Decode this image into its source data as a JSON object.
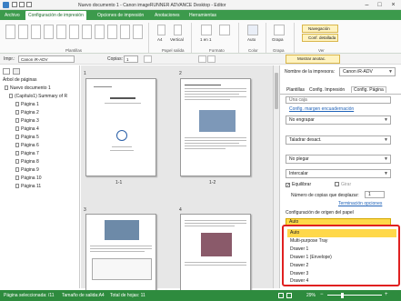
{
  "window": {
    "title": "Nuevo documento 1 - Canon imageRUNNER ADVANCE Desktop - Editor"
  },
  "ribbon_tabs": [
    "Archivo",
    "Configuración de impresión",
    "Opciones de impresión",
    "Anotaciones",
    "Herramientas"
  ],
  "ribbon": {
    "groups": [
      "Plantillas",
      "Papel salida",
      "Formato",
      "Color",
      "Grapa",
      "Ver"
    ],
    "paper_size": "A4",
    "orientation": "Vertical",
    "nup": "1 en 1",
    "color_mode": "Auto",
    "staple": "Grapa",
    "navigation": "Navegación",
    "detailed_config": "Conf. detallada"
  },
  "toolbar2": {
    "printer_label": "Impr.:",
    "printer_value": "Canon iR-ADV",
    "copies_label": "Copias:",
    "copies_value": "1",
    "show_annotations": "Mostrar anotac."
  },
  "left": {
    "tree_header": "Árbol de páginas",
    "items": [
      "Nuevo documento 1",
      "(Capítulo1) Summary of R",
      "Página 1",
      "Página 2",
      "Página 3",
      "Página 4",
      "Página 5",
      "Página 6",
      "Página 7",
      "Página 8",
      "Página 9",
      "Página 10",
      "Página 11"
    ]
  },
  "preview": {
    "page_labels": [
      "1",
      "1-1",
      "2",
      "1-2",
      "3",
      "4"
    ]
  },
  "right": {
    "printer_label": "Nombre de la impresora:",
    "printer_value": "Canon iR-ADV",
    "tabs": [
      "Plantillas",
      "Config. Impresión",
      "Config. Página"
    ],
    "combo_cut": "Una caja",
    "settings_link": "Config. margen encuadernación",
    "no_staple": "No engrapar",
    "punch": "Taladrar desact.",
    "no_fold": "No plegar",
    "interleave": "Intercalar",
    "balanced_label": "Equilibrar",
    "rotate_label": "Girar",
    "copies_label": "Número de copias que desplazar:",
    "copies_value": "1",
    "finishing_link": "Terminación opciones",
    "paper_source_label": "Configuración de origen del papel",
    "paper_source_selected": "Auto",
    "paper_source_options": [
      "Auto",
      "Multi-purpose Tray",
      "Drawer 1",
      "Drawer 1 (Envelope)",
      "Drawer 2",
      "Drawer 3",
      "Drawer 4"
    ],
    "highlight_color": "#e02020"
  },
  "status": {
    "selected": "Página seleccionada: /11",
    "output_size": "Tamaño de salida:A4",
    "total": "Total de hojas: 11",
    "zoom": "29%"
  },
  "colors": {
    "accent": "#3c9a4c",
    "status": "#2e8b3e",
    "selection": "#ffd84a"
  }
}
